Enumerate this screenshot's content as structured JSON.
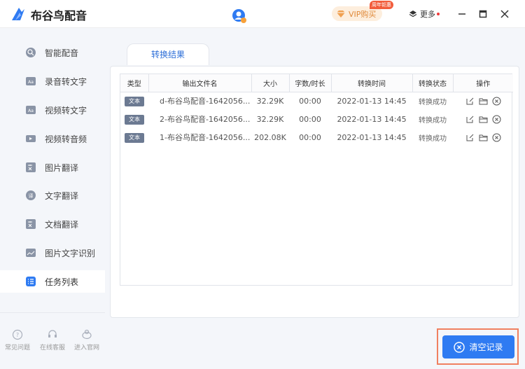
{
  "app": {
    "title": "布谷鸟配音"
  },
  "header": {
    "vip_label": "VIP购买",
    "vip_badge": "周年钜惠",
    "more_label": "更多"
  },
  "sidebar": {
    "items": [
      {
        "label": "智能配音",
        "icon": "smart-voice-icon"
      },
      {
        "label": "录音转文字",
        "icon": "record-to-text-icon"
      },
      {
        "label": "视频转文字",
        "icon": "video-to-text-icon"
      },
      {
        "label": "视频转音频",
        "icon": "video-to-audio-icon"
      },
      {
        "label": "图片翻译",
        "icon": "image-translate-icon"
      },
      {
        "label": "文字翻译",
        "icon": "text-translate-icon"
      },
      {
        "label": "文档翻译",
        "icon": "doc-translate-icon"
      },
      {
        "label": "图片文字识别",
        "icon": "ocr-icon"
      },
      {
        "label": "任务列表",
        "icon": "task-list-icon",
        "active": true
      }
    ],
    "footer": [
      {
        "label": "常见问题",
        "icon": "help-icon"
      },
      {
        "label": "在线客服",
        "icon": "customer-service-icon"
      },
      {
        "label": "进入官网",
        "icon": "website-icon"
      }
    ]
  },
  "main": {
    "tab_label": "转换结果",
    "table": {
      "headers": [
        "类型",
        "输出文件名",
        "大小",
        "字数/时长",
        "转换时间",
        "转换状态",
        "操作"
      ],
      "rows": [
        {
          "type": "文本",
          "name": "d-布谷鸟配音-1642056...",
          "size": "32.29K",
          "duration": "00:00",
          "time": "2022-01-13 14:45",
          "status": "转换成功"
        },
        {
          "type": "文本",
          "name": "2-布谷鸟配音-1642056...",
          "size": "32.29K",
          "duration": "00:00",
          "time": "2022-01-13 14:45",
          "status": "转换成功"
        },
        {
          "type": "文本",
          "name": "1-布谷鸟配音-1642056...",
          "size": "202.08K",
          "duration": "00:00",
          "time": "2022-01-13 14:45",
          "status": "转换成功"
        }
      ]
    },
    "clear_label": "清空记录"
  },
  "colors": {
    "accent": "#2f7bf2",
    "tab_text": "#2e6fd8",
    "badge": "#6c7a92",
    "highlight_border": "#f08060"
  }
}
